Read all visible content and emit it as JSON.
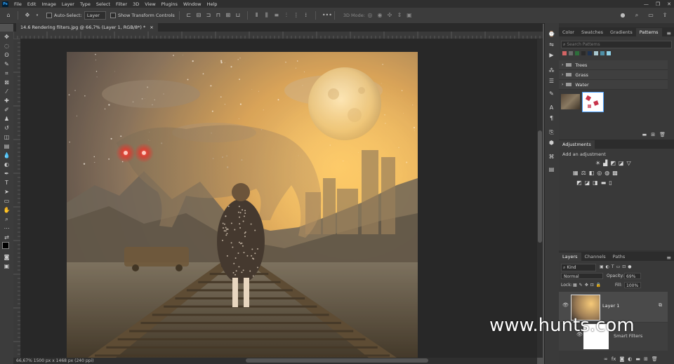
{
  "app": {
    "logo": "Ps",
    "menu": [
      "File",
      "Edit",
      "Image",
      "Layer",
      "Type",
      "Select",
      "Filter",
      "3D",
      "View",
      "Plugins",
      "Window",
      "Help"
    ]
  },
  "options_bar": {
    "auto_select_label": "Auto-Select:",
    "auto_select_value": "Layer",
    "show_transform_label": "Show Transform Controls",
    "mode_3d_label": "3D Mode:"
  },
  "document": {
    "tab_title": "14.6 Rendering filters.jpg @ 66,7% (Layer 1, RGB/8*) *",
    "tab_close": "×",
    "status": "66,67%   1500 px x 1468 px (240 ppi)"
  },
  "panels": {
    "top_tabs": [
      "Color",
      "Swatches",
      "Gradients",
      "Patterns"
    ],
    "active_top_tab": "Patterns",
    "search_placeholder": "Search Patterns",
    "pattern_folders": [
      "Trees",
      "Grass",
      "Water"
    ],
    "adjustments_title": "Adjustments",
    "adjustments_hint": "Add an adjustment",
    "layers_tabs": [
      "Layers",
      "Channels",
      "Paths"
    ],
    "kind_label": "Kind",
    "blend_mode": "Normal",
    "opacity_label": "Opacity:",
    "opacity_value": "69%",
    "lock_label": "Lock:",
    "fill_label": "Fill:",
    "fill_value": "100%",
    "layer_name": "Layer 1",
    "smart_filters_label": "Smart Filters"
  },
  "watermark": "www.hunts.com",
  "colors": {
    "ui_dark": "#2f2f2f",
    "panel": "#393939",
    "accent_blue": "#31a8ff",
    "glow": "#f2b04a"
  }
}
